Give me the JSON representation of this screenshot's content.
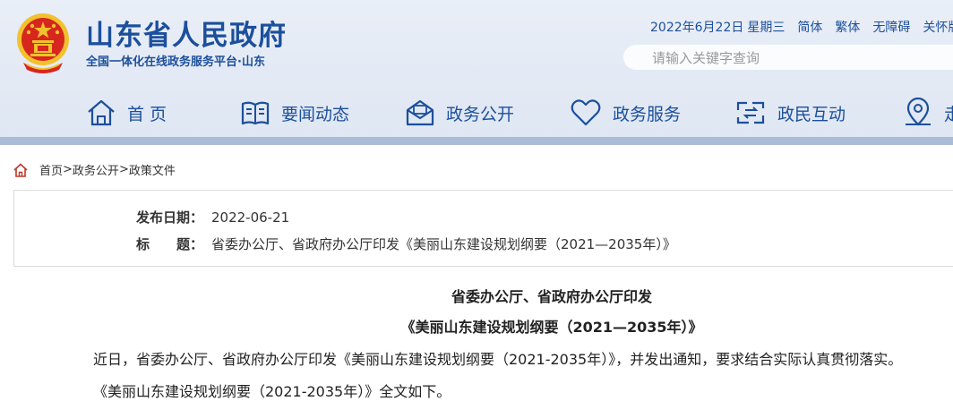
{
  "header": {
    "site_title": "山东省人民政府",
    "site_subtitle": "全国一体化在线政务服务平台·山东",
    "date": "2022年6月22日",
    "weekday": "星期三",
    "links": [
      "简体",
      "繁体",
      "无障碍",
      "关怀版"
    ],
    "search_placeholder": "请输入关键字查询"
  },
  "nav": {
    "items": [
      {
        "label": "首 页",
        "icon": "home-icon"
      },
      {
        "label": "要闻动态",
        "icon": "news-icon"
      },
      {
        "label": "政务公开",
        "icon": "envelope-icon"
      },
      {
        "label": "政务服务",
        "icon": "heart-icon"
      },
      {
        "label": "政民互动",
        "icon": "interaction-icon"
      },
      {
        "label": "走",
        "icon": "location-icon"
      }
    ]
  },
  "breadcrumb": {
    "icon": "home-icon",
    "items": [
      "首页",
      "政务公开",
      "政策文件"
    ],
    "separator": ">"
  },
  "info": {
    "date_label": "发布日期：",
    "date_value": "2022-06-21",
    "title_label": "标　　题：",
    "title_value": "省委办公厅、省政府办公厅印发《美丽山东建设规划纲要（2021—2035年）》"
  },
  "article": {
    "heading1": "省委办公厅、省政府办公厅印发",
    "heading2": "《美丽山东建设规划纲要（2021—2035年）》",
    "para1": "近日，省委办公厅、省政府办公厅印发《美丽山东建设规划纲要（2021-2035年）》，并发出通知，要求结合实际认真贯彻落实。",
    "para2": "《美丽山东建设规划纲要（2021-2035年）》全文如下。"
  },
  "colors": {
    "brand_blue": "#1c4f9c",
    "header_bg": "#e5ebf5",
    "emblem_red": "#d7261e",
    "emblem_gold": "#f2c12e"
  }
}
